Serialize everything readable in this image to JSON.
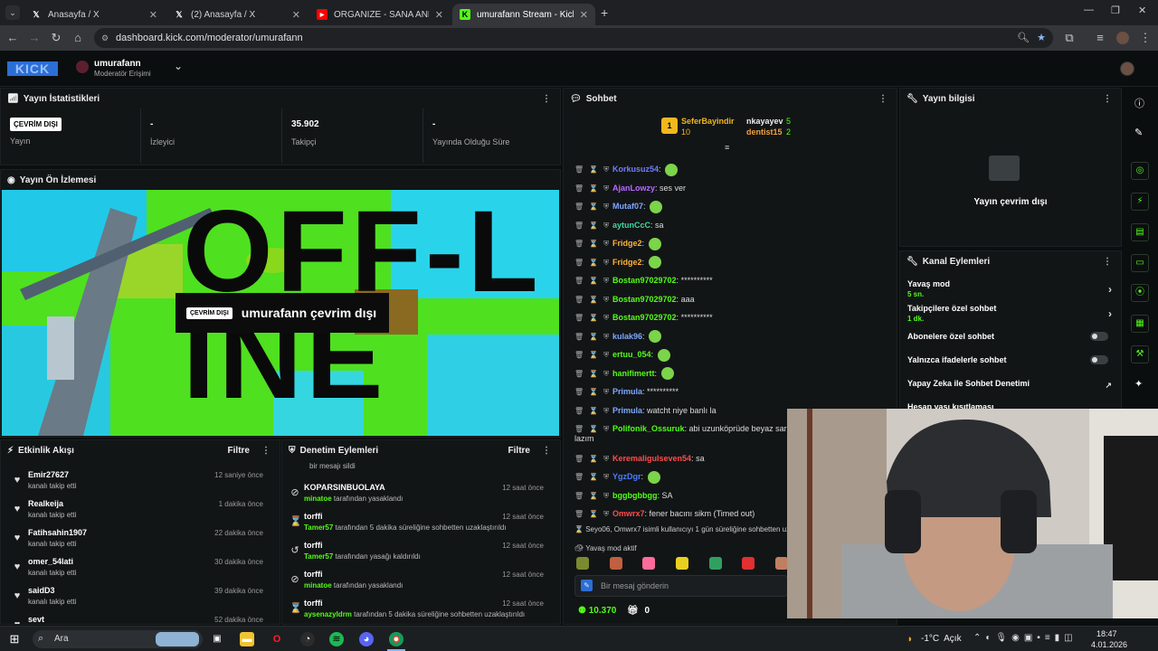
{
  "browser": {
    "tabs": [
      {
        "title": "Anasayfa / X",
        "icon": "x-logo-icon"
      },
      {
        "title": "(2) Anasayfa / X",
        "icon": "x-logo-icon"
      },
      {
        "title": "ORGANIZE - SANA ANLATMAK",
        "icon": "youtube-icon"
      },
      {
        "title": "umurafann Stream - Kick Dashb",
        "icon": "kick-icon"
      }
    ],
    "url": "dashboard.kick.com/moderator/umurafann"
  },
  "header": {
    "logo": "KICK",
    "channel": "umurafann",
    "role": "Moderatör Erişimi"
  },
  "stats": {
    "title": "Yayın İstatistikleri",
    "items": [
      {
        "value": "ÇEVRİM DIŞI",
        "label": "Yayın"
      },
      {
        "value": "-",
        "label": "İzleyici"
      },
      {
        "value": "35.902",
        "label": "Takipçi"
      },
      {
        "value": "-",
        "label": "Yayında Olduğu Süre"
      }
    ]
  },
  "preview": {
    "title": "Yayın Ön İzlemesi",
    "badge": "ÇEVRİM DIŞI",
    "text": "umurafann çevrim dışı",
    "bg_word": "OFF-LINE"
  },
  "activity": {
    "title": "Etkinlik Akışı",
    "filter": "Filtre",
    "items": [
      {
        "name": "Emir27627",
        "sub": "kanalı takip etti",
        "time": "12 saniye önce"
      },
      {
        "name": "Realkeija",
        "sub": "kanalı takip etti",
        "time": "1 dakika önce"
      },
      {
        "name": "Fatihsahin1907",
        "sub": "kanalı takip etti",
        "time": "22 dakika önce"
      },
      {
        "name": "omer_54lati",
        "sub": "kanalı takip etti",
        "time": "30 dakika önce"
      },
      {
        "name": "saidD3",
        "sub": "kanalı takip etti",
        "time": "39 dakika önce"
      },
      {
        "name": "sevt",
        "sub": "",
        "time": "52 dakika önce"
      }
    ]
  },
  "modlog": {
    "title": "Denetim Eylemleri",
    "filter": "Filtre",
    "top_text": "bir mesajı sildi",
    "items": [
      {
        "name": "KOPARSINBUOLAYA",
        "actor": "minatoe",
        "rest": " tarafından yasaklandı",
        "time": "12 saat önce",
        "icon": "ban-icon"
      },
      {
        "name": "torffi",
        "actor": "Tamer57",
        "rest": " tarafından 5 dakika süreliğine sohbetten uzaklaştırıldı",
        "time": "12 saat önce",
        "icon": "hourglass-icon"
      },
      {
        "name": "torffi",
        "actor": "Tamer57",
        "rest": " tarafından yasağı kaldırıldı",
        "time": "12 saat önce",
        "icon": "undo-icon"
      },
      {
        "name": "torffi",
        "actor": "minatoe",
        "rest": " tarafından yasaklandı",
        "time": "12 saat önce",
        "icon": "ban-icon"
      },
      {
        "name": "torffi",
        "actor": "aysenazyldrm",
        "rest": " tarafından 5 dakika süreliğine sohbetten uzaklaştırıldı",
        "time": "12 saat önce",
        "icon": "hourglass-icon"
      }
    ]
  },
  "chat": {
    "title": "Sohbet",
    "top": [
      {
        "name": "SeferBayindir",
        "count": "10"
      },
      {
        "name": "nkayayev",
        "count": "5"
      },
      {
        "name": "dentist15",
        "count": "2"
      }
    ],
    "messages": [
      {
        "user": "Korkusuz54",
        "color": "#6f7dff",
        "text": ""
      },
      {
        "user": "AjanLowzy",
        "color": "#b76bff",
        "text": "ses ver"
      },
      {
        "user": "Mutaf07",
        "color": "#7fa8ff",
        "text": ""
      },
      {
        "user": "aytunCcC",
        "color": "#3fd6a0",
        "text": "sa"
      },
      {
        "user": "Fridge2",
        "color": "#ffb13c",
        "text": ""
      },
      {
        "user": "Fridge2",
        "color": "#ffb13c",
        "text": ""
      },
      {
        "user": "Bostan97029702",
        "color": "#53fc18",
        "text": "**********"
      },
      {
        "user": "Bostan97029702",
        "color": "#53fc18",
        "text": "aaa"
      },
      {
        "user": "Bostan97029702",
        "color": "#53fc18",
        "text": "**********"
      },
      {
        "user": "kulak96",
        "color": "#7fa8ff",
        "text": ""
      },
      {
        "user": "ertuu_054",
        "color": "#53fc18",
        "text": ""
      },
      {
        "user": "hanifimertt",
        "color": "#53fc18",
        "text": ""
      },
      {
        "user": "Primula",
        "color": "#7fa8ff",
        "text": "**********"
      },
      {
        "user": "Primula",
        "color": "#7fa8ff",
        "text": "watcht niye banlı la"
      },
      {
        "user": "Polifonik_Ossuruk",
        "color": "#53fc18",
        "text": "abi uzunköprüde beyaz saraya"
      },
      {
        "user": "Keremaligulseven54",
        "color": "#ff4d4d",
        "text": "sa"
      },
      {
        "user": "YgzDgr",
        "color": "#4d7dff",
        "text": ""
      },
      {
        "user": "bggbgbbgg",
        "color": "#53fc18",
        "text": "SA"
      },
      {
        "user": "Omwrx7",
        "color": "#ff4d4d",
        "text": "fener bacını sikm (Timed out)"
      }
    ],
    "wrap_text": "lazım",
    "system": "Seyo06, Omwrx7 isimli kullanıcıyı 1 gün süreliğine sohbetten uzak",
    "slow": "Yavaş mod aktif",
    "input_placeholder": "Bir mesaj gönderin",
    "points": "10.370",
    "gifts": "0"
  },
  "stream_info": {
    "title": "Yayın bilgisi",
    "offline": "Yayın çevrim dışı"
  },
  "channel_actions": {
    "title": "Kanal Eylemleri",
    "items": [
      {
        "label": "Yavaş mod",
        "sub": "5 sn."
      },
      {
        "label": "Takipçilere özel sohbet",
        "sub": "1 dk."
      },
      {
        "label": "Abonelere özel sohbet"
      },
      {
        "label": "Yalnızca ifadelerle sohbet"
      },
      {
        "label": "Yapay Zeka ile Sohbet Denetimi"
      },
      {
        "label": "Hesap yaşı kısıtlaması"
      }
    ]
  },
  "taskbar": {
    "search": "Ara",
    "weather": "-1°C  Açık",
    "time": "18:47",
    "date": "4.01.2026"
  }
}
